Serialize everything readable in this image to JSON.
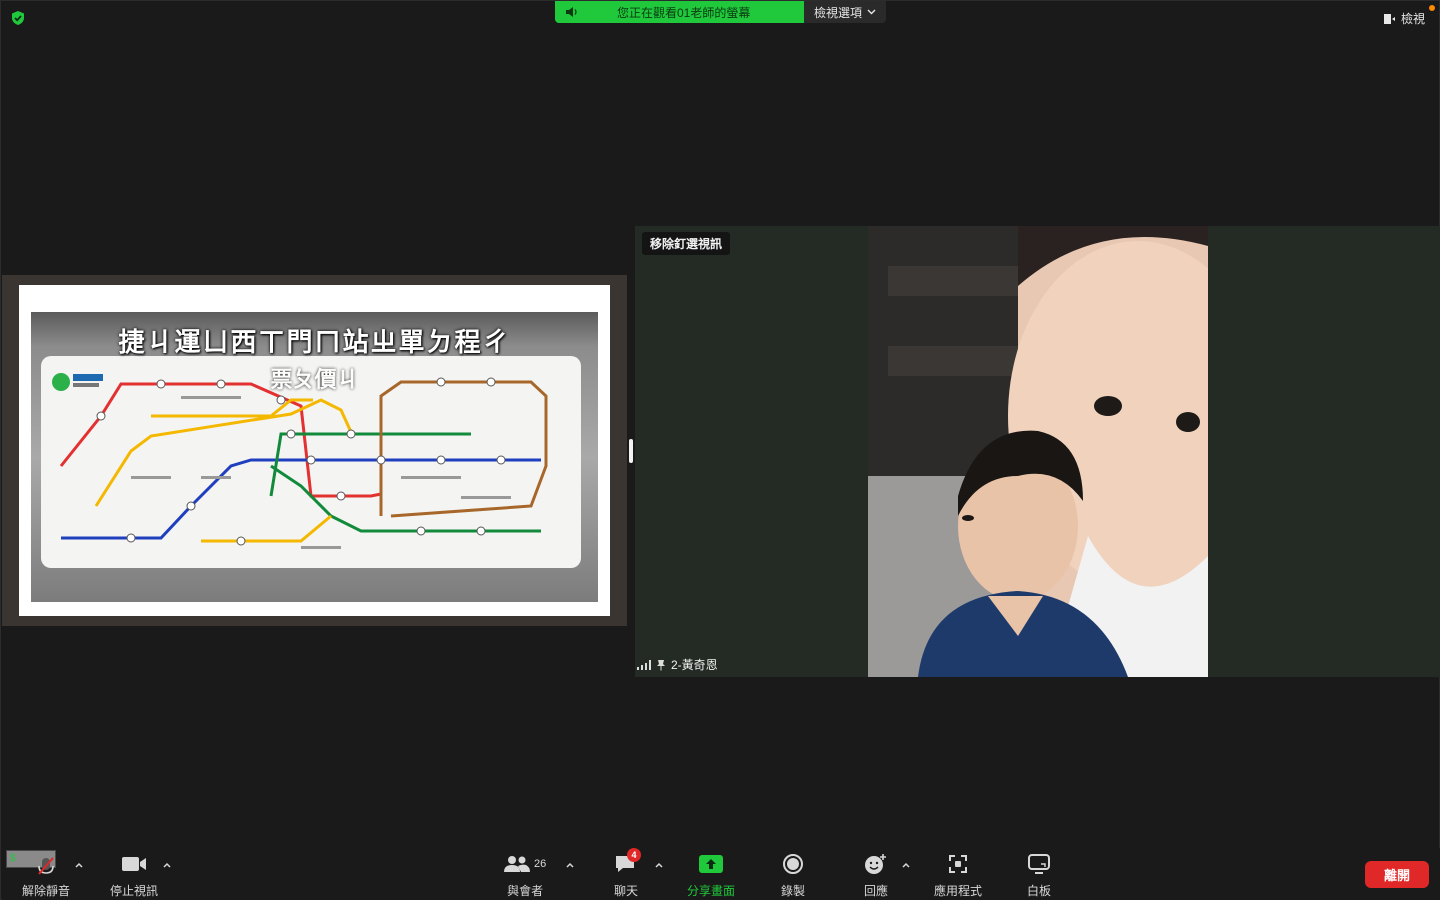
{
  "top": {
    "banner_text": "您正在觀看01老師的螢幕",
    "view_options_label": "檢視選項",
    "view_label": "檢視"
  },
  "share": {
    "slide_title": "捷ㄐ運ㄩ西ㄒ門ㄇ站ㄓ單ㄉ程ㄔ",
    "slide_subtitle": "票ㄆ價ㄐ"
  },
  "video": {
    "unpin_label": "移除釘選視訊",
    "participant_name": "2-黃奇恩"
  },
  "toolbar": {
    "talking_indicator": "$",
    "unmute_label": "解除靜音",
    "stop_video_label": "停止視訊",
    "participants_label": "與會者",
    "participants_count": "26",
    "chat_label": "聊天",
    "chat_badge": "4",
    "share_label": "分享畫面",
    "record_label": "錄製",
    "reactions_label": "回應",
    "apps_label": "應用程式",
    "whiteboard_label": "白板",
    "leave_label": "離開"
  },
  "colors": {
    "share_green": "#1fc93b",
    "leave_red": "#e02828",
    "background": "#1a1a1a"
  }
}
